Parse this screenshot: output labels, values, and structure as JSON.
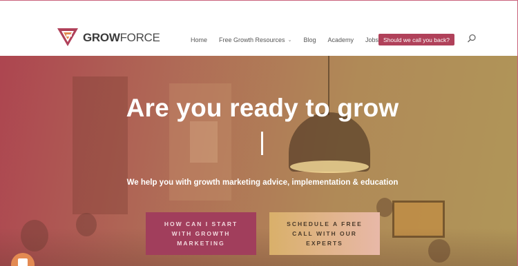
{
  "brand": {
    "name_bold": "GROW",
    "name_light": "FORCE",
    "colors": {
      "primary": "#b0415a",
      "accent": "#e38a52",
      "text": "#3b3b3b"
    }
  },
  "nav": {
    "items": [
      {
        "label": "Home"
      },
      {
        "label": "Free Growth Resources",
        "has_dropdown": true
      },
      {
        "label": "Blog"
      },
      {
        "label": "Academy"
      },
      {
        "label": "Jobs"
      }
    ],
    "cta_label": "Should we call you back?",
    "search_icon": "search-icon"
  },
  "hero": {
    "title": "Are you ready to grow",
    "subtitle": "We help you with growth marketing advice, implementation & education",
    "primary_button": "HOW CAN I START WITH GROWTH MARKETING",
    "secondary_button": "SCHEDULE A FREE CALL WITH OUR EXPERTS"
  },
  "chat_widget": {
    "icon": "chat-icon"
  }
}
